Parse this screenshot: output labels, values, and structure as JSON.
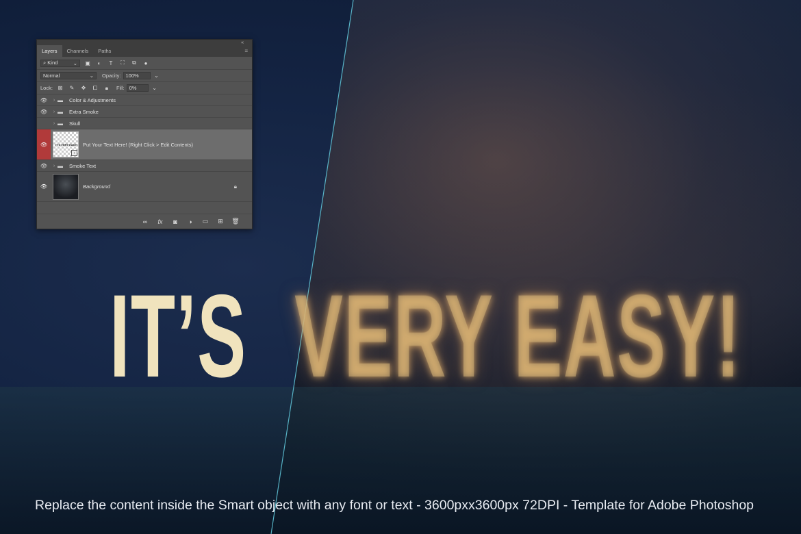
{
  "artwork": {
    "headline_left": "IT’S",
    "headline_smoke": "VERY EASY!",
    "caption": "Replace the content inside the Smart object with any font or text - 3600pxx3600px 72DPI - Template for Adobe Photoshop",
    "colors": {
      "background_dark": "#12203a",
      "headline_cream": "#f0e3bd",
      "smoke_gold": "#d6b478",
      "divider_cyan": "#5fc3d6"
    }
  },
  "layers_panel": {
    "collapse_label": "«",
    "tabs": [
      {
        "label": "Layers",
        "active": true
      },
      {
        "label": "Channels",
        "active": false
      },
      {
        "label": "Paths",
        "active": false
      }
    ],
    "filter": {
      "search_icon": "⌕",
      "kind_label": "Kind"
    },
    "blend_mode": "Normal",
    "opacity_label": "Opacity:",
    "opacity_value": "100%",
    "lock_label": "Lock:",
    "fill_label": "Fill:",
    "fill_value": "0%",
    "layers": [
      {
        "name": "Color & Adjustments",
        "type": "group",
        "visible": true
      },
      {
        "name": "Extra Smoke",
        "type": "group",
        "visible": true
      },
      {
        "name": "Skull",
        "type": "group",
        "visible": false
      },
      {
        "name": "Put Your Text Here! (Right Click > Edit Contents)",
        "type": "smart-object",
        "visible": true,
        "selected": true,
        "thumb_text": "IT'S VERY EASY!"
      },
      {
        "name": "Smoke Text",
        "type": "group",
        "visible": true
      },
      {
        "name": "Background",
        "type": "pixel",
        "visible": true,
        "locked": true
      }
    ]
  }
}
